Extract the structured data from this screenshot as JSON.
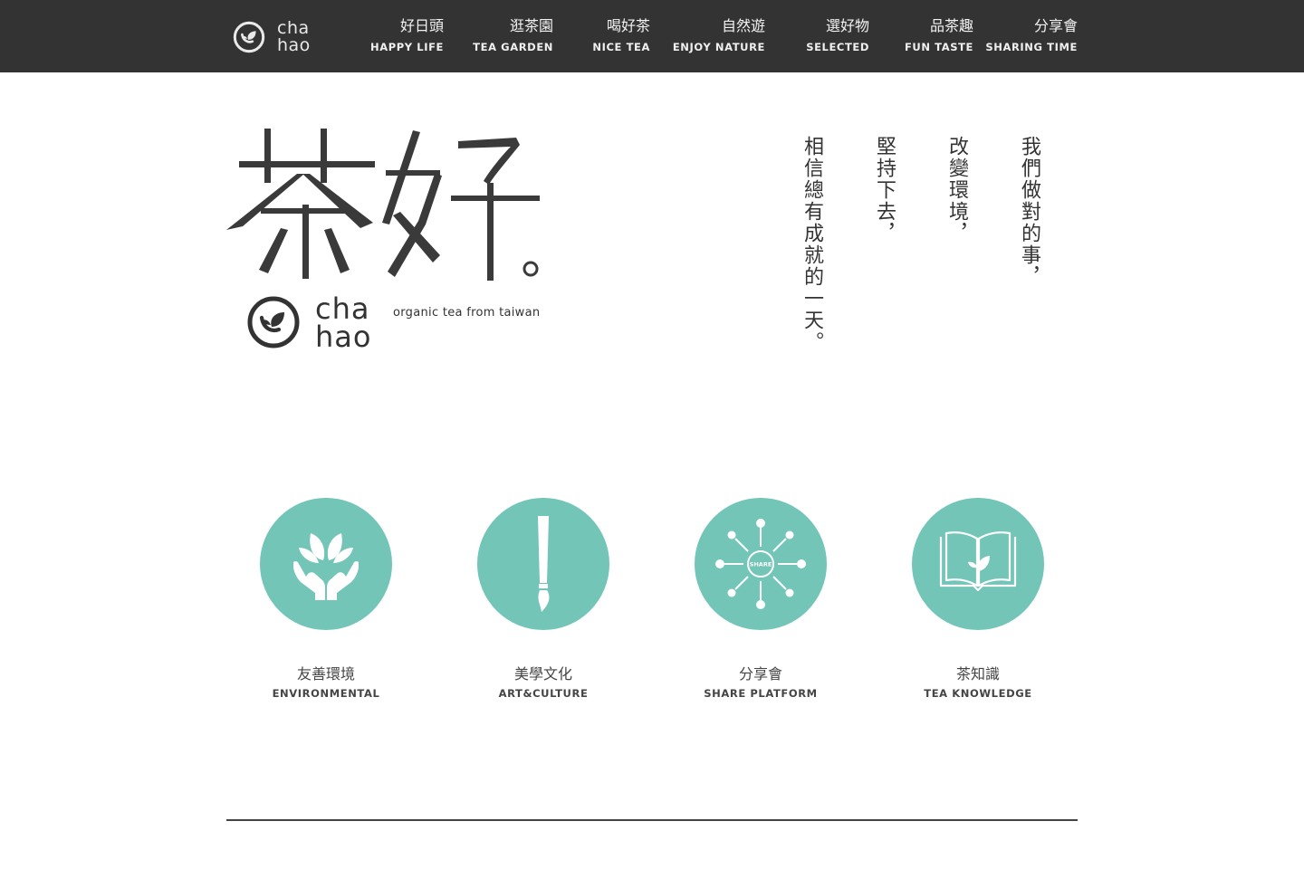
{
  "brand": {
    "logo_line1": "cha",
    "logo_line2": "hao",
    "hero_title": "茶好。",
    "tagline": "organic tea from taiwan"
  },
  "nav": {
    "items": [
      {
        "zh": "好日頭",
        "en": "HAPPY LIFE"
      },
      {
        "zh": "逛茶園",
        "en": "TEA GARDEN"
      },
      {
        "zh": "喝好茶",
        "en": "NICE TEA"
      },
      {
        "zh": "自然遊",
        "en": "ENJOY NATURE"
      },
      {
        "zh": "選好物",
        "en": "SELECTED"
      },
      {
        "zh": "品茶趣",
        "en": "FUN TASTE"
      },
      {
        "zh": "分享會",
        "en": "SHARING TIME"
      }
    ]
  },
  "poem": {
    "lines": [
      "我們做對的事，",
      "改變環境，",
      "堅持下去，",
      "相信總有成就的一天。"
    ]
  },
  "features": [
    {
      "zh": "友善環境",
      "en": "ENVIRONMENTAL",
      "icon": "hands-leaf-icon"
    },
    {
      "zh": "美學文化",
      "en": "ART&CULTURE",
      "icon": "brush-icon"
    },
    {
      "zh": "分享會",
      "en": "SHARE PLATFORM",
      "icon": "share-network-icon",
      "icon_text": "SHARE"
    },
    {
      "zh": "茶知識",
      "en": "TEA KNOWLEDGE",
      "icon": "book-leaf-icon"
    }
  ],
  "colors": {
    "topbar": "#333333",
    "accent": "#72c5b7",
    "text": "#333333"
  }
}
